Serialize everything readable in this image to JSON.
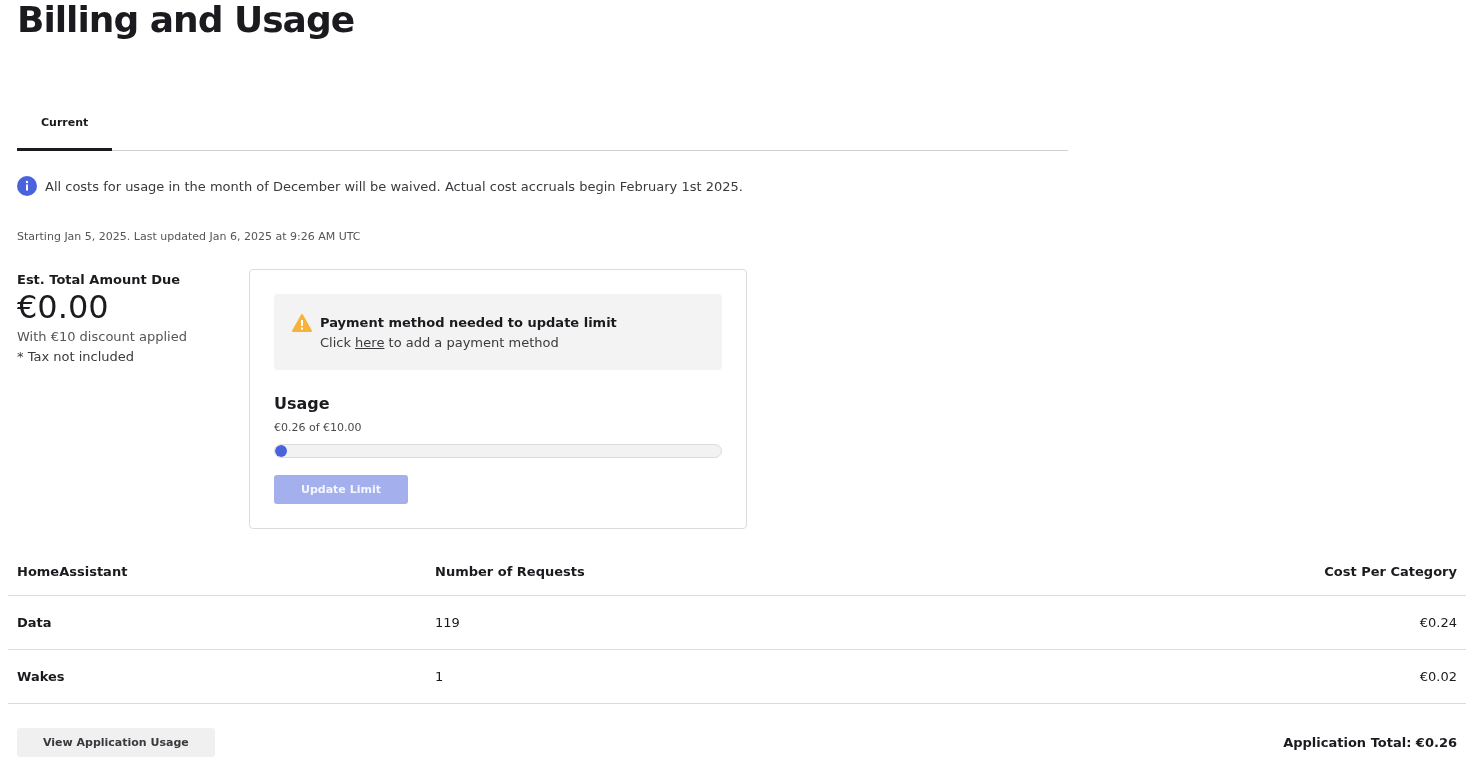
{
  "page_title": "Billing and Usage",
  "tabs": [
    {
      "label": "Current",
      "selected": true
    }
  ],
  "notice": {
    "text": "All costs for usage in the month of December will be waived. Actual cost accruals begin February 1st 2025."
  },
  "period": "Starting Jan 5, 2025. Last updated Jan 6, 2025 at 9:26 AM UTC",
  "summary": {
    "label": "Est. Total Amount Due",
    "amount": "€0.00",
    "discount": "With €10 discount applied",
    "tax_note": "* Tax not included"
  },
  "usage_card": {
    "warning": {
      "title": "Payment method needed to update limit",
      "text_before": "Click ",
      "link": "here",
      "text_after": " to add a payment method"
    },
    "heading": "Usage",
    "reading": "€0.26 of €10.00",
    "level": 0.026,
    "button": {
      "label": "Update Limit",
      "disabled": true
    }
  },
  "table": {
    "columns": [
      "HomeAssistant",
      "Number of Requests",
      "Cost Per Category"
    ],
    "rows": [
      [
        "Data",
        "119",
        "€0.24"
      ],
      [
        "Wakes",
        "1",
        "€0.02"
      ]
    ]
  },
  "footer": {
    "button": "View Application Usage",
    "total": "Application Total: €0.26"
  }
}
